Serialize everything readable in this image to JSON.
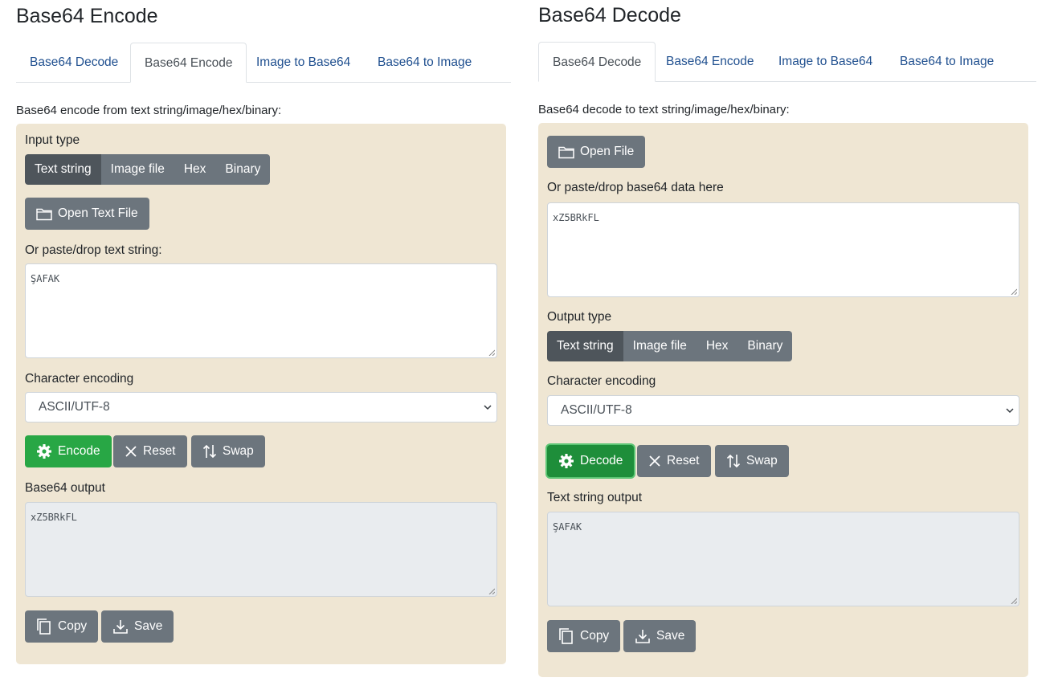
{
  "encode": {
    "title": "Base64 Encode",
    "tabs": [
      "Base64 Decode",
      "Base64 Encode",
      "Image to Base64",
      "Base64 to Image"
    ],
    "description": "Base64 encode from text string/image/hex/binary:",
    "input_type_label": "Input type",
    "input_types": [
      "Text string",
      "Image file",
      "Hex",
      "Binary"
    ],
    "open_file_label": "Open Text File",
    "paste_label": "Or paste/drop text string:",
    "input_value": "ŞAFAK",
    "encoding_label": "Character encoding",
    "encoding_value": "ASCII/UTF-8",
    "encode_button": "Encode",
    "reset_button": "Reset",
    "swap_button": "Swap",
    "output_label": "Base64 output",
    "output_value": "xZ5BRkFL",
    "copy_button": "Copy",
    "save_button": "Save"
  },
  "decode": {
    "title": "Base64 Decode",
    "tabs": [
      "Base64 Decode",
      "Base64 Encode",
      "Image to Base64",
      "Base64 to Image"
    ],
    "description": "Base64 decode to text string/image/hex/binary:",
    "open_file_label": "Open File",
    "paste_label": "Or paste/drop base64 data here",
    "input_value": "xZ5BRkFL",
    "output_type_label": "Output type",
    "output_types": [
      "Text string",
      "Image file",
      "Hex",
      "Binary"
    ],
    "encoding_label": "Character encoding",
    "encoding_value": "ASCII/UTF-8",
    "decode_button": "Decode",
    "reset_button": "Reset",
    "swap_button": "Swap",
    "output_label": "Text string output",
    "output_value": "ŞAFAK",
    "copy_button": "Copy",
    "save_button": "Save"
  },
  "colors": {
    "panel_bg": "#efe6d3",
    "button_gray": "#6c757d",
    "button_active": "#4e555b",
    "button_green": "#28a745",
    "link_blue": "#1f4f8f"
  }
}
